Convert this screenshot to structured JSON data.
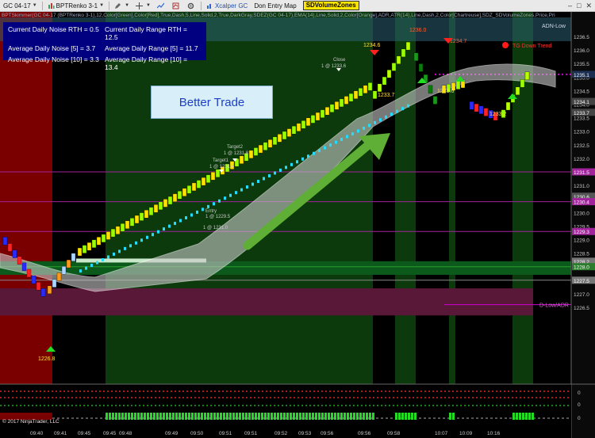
{
  "toolbar": {
    "instrument": "GC 04-17",
    "bar_type": "BPTRenko 3-1",
    "indicator1": "Xcalper GC",
    "indicator2": "Don Entry Map",
    "volume_zones": "SDVolumeZones"
  },
  "indicator_strip": "BPTSkimmer(GC 04-17 (BPTRenko 3-1),12,Color[Green],Color[Red],True,Dash,5,Line,Solid,2,True,DarkGray,SDEZ(GC 04-17),EMA(14),Line,Solid,2,Color[Orange],ADR,ATR(14),Line,Dash,2,Color[Chartreuse],SDZ_SDVolumeZones,Price,Price(GC 04-17)",
  "info_box": {
    "noise_rth": "Current Daily Noise RTH = 0.5",
    "range_rth": "Current Daily Range RTH = 12.5",
    "noise5": "Average Daily Noise [5] = 3.7",
    "range5": "Average Daily Range [5] = 11.7",
    "noise10": "Average Daily Noise [10] = 3.3",
    "range10": "Average Daily Range [10] = 13.4"
  },
  "annotation": "Better Trade",
  "labels": {
    "adn_low": "ADN-Low",
    "tg_down": "TG Down Trend",
    "d_low_adr": "D-Low/ADR",
    "close": "Close",
    "close_detail": "1 @ 1233.6",
    "target2": "Target2",
    "target2_detail": "1 @ 1231.8",
    "target1": "Target1",
    "target1_detail": "1 @ 1231.4",
    "entry": "Entry",
    "entry_detail": "1 @ 1229.5",
    "entry2": "1 @ 1231.0",
    "low1": "1226.8",
    "high1": "1234.6",
    "high2": "1236.0",
    "high3": "1234.7",
    "low2": "1233.7",
    "low3": "1233.6",
    "low4": "1233.2"
  },
  "price_axis": [
    "1236.5",
    "1236.0",
    "1235.5",
    "1235.0",
    "1234.5",
    "1234.0",
    "1233.5",
    "1233.0",
    "1232.5",
    "1232.0",
    "1231.5",
    "1231.0",
    "1230.5",
    "1230.0",
    "1229.5",
    "1229.0",
    "1228.5",
    "1228.0",
    "1227.5",
    "1227.0",
    "1226.5"
  ],
  "price_badges": [
    {
      "label": "1235.1",
      "price": 1235.1,
      "color": "#1a2f52"
    },
    {
      "label": "1234.1",
      "price": 1234.1,
      "color": "#444444"
    },
    {
      "label": "1233.7",
      "price": 1233.7,
      "color": "#444444"
    },
    {
      "label": "1231.5",
      "price": 1231.5,
      "color": "#a3239d"
    },
    {
      "label": "1230.6",
      "price": 1230.6,
      "color": "#555555"
    },
    {
      "label": "1230.4",
      "price": 1230.4,
      "color": "#a3239d"
    },
    {
      "label": "1229.3",
      "price": 1229.3,
      "color": "#a3239d"
    },
    {
      "label": "1228.2",
      "price": 1228.2,
      "color": "#777777"
    },
    {
      "label": "1228.0",
      "price": 1228.0,
      "color": "#2a7d2a"
    },
    {
      "label": "1227.5",
      "price": 1227.5,
      "color": "#777777"
    }
  ],
  "time_axis": [
    "09:40",
    "09:41",
    "09:45",
    "09:45",
    "09:48",
    "09:49",
    "09:50",
    "09:51",
    "09:51",
    "09:52",
    "09:53",
    "09:56",
    "09:56",
    "09:58",
    "10:07",
    "10:09",
    "10:16"
  ],
  "lower_axis": [
    "0",
    "0",
    "0"
  ],
  "copyright": "© 2017 NinjaTrader, LLC"
}
